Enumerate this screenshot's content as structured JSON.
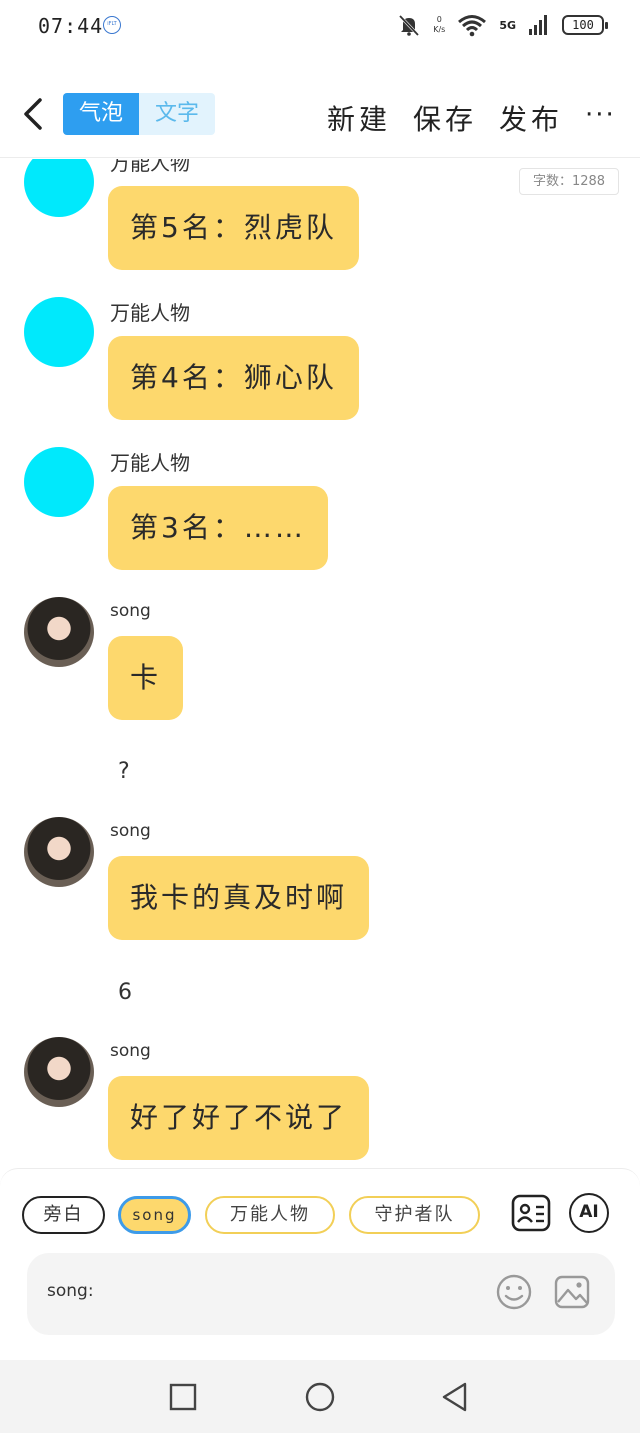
{
  "status_bar": {
    "time": "07:44",
    "carrier_badge": "iFLT",
    "net_speed_value": "0",
    "net_speed_unit": "K/s",
    "network": "5G",
    "battery": "100"
  },
  "header": {
    "tab_bubble": "气泡",
    "tab_text": "文字",
    "new_label": "新建",
    "save_label": "保存",
    "publish_label": "发布",
    "more_label": "···"
  },
  "word_count": "字数：1288",
  "messages": [
    {
      "name": "万能人物",
      "text": "第5名：烈虎队"
    },
    {
      "name": "万能人物",
      "text": "第4名：狮心队"
    },
    {
      "name": "万能人物",
      "text": "第3名：……"
    },
    {
      "name": "song",
      "text": "卡"
    },
    {
      "narration": "?"
    },
    {
      "name": "song",
      "text": "我卡的真及时啊"
    },
    {
      "narration": "6"
    },
    {
      "name": "song",
      "text": "好了好了不说了"
    }
  ],
  "roles": {
    "narrator": "旁白",
    "song": "song",
    "universal": "万能人物",
    "guardians": "守护者队",
    "ai_label": "AI"
  },
  "input": {
    "prompt": "song:"
  },
  "colors": {
    "bubble": "#fdd86d",
    "accent_blue": "#2e9ef0",
    "avatar_cyan": "#00e9fc",
    "chip_border_yellow": "#f2cf57"
  }
}
